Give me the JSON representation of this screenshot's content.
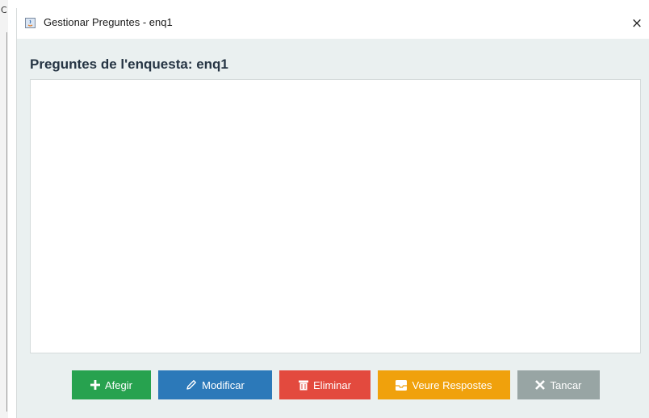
{
  "background_window": {
    "edge_char": "C"
  },
  "dialog": {
    "title": "Gestionar Preguntes - enq1",
    "close_glyph": "×",
    "heading": "Preguntes de l'enquesta: enq1",
    "questions": []
  },
  "buttons": {
    "add": {
      "label": "Afegir",
      "icon": "plus-icon",
      "color": "#27a24f"
    },
    "edit": {
      "label": "Modificar",
      "icon": "pencil-icon",
      "color": "#2c79b9"
    },
    "delete": {
      "label": "Eliminar",
      "icon": "trash-icon",
      "color": "#e34a3e"
    },
    "view_answers": {
      "label": "Veure Respostes",
      "icon": "inbox-icon",
      "color": "#f0a10c"
    },
    "close": {
      "label": "Tancar",
      "icon": "x-icon",
      "color": "#98a5a4"
    }
  }
}
